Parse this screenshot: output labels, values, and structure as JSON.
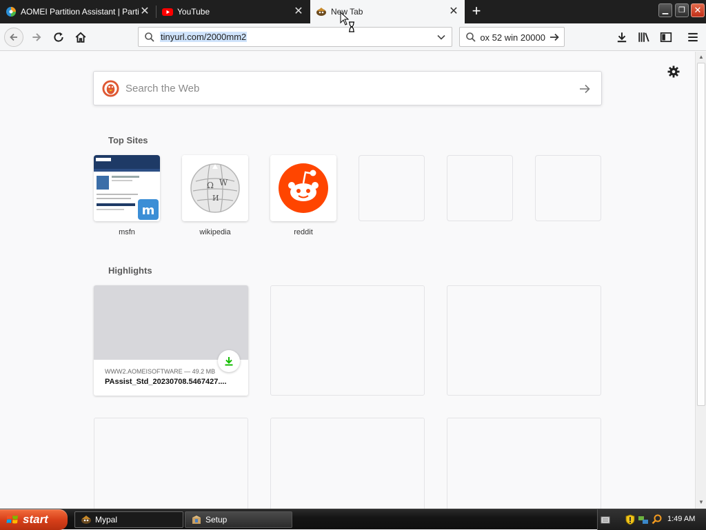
{
  "browser": {
    "tabs": [
      {
        "title": "AOMEI Partition Assistant | Partiti",
        "icon": "aomei-favicon",
        "active": false
      },
      {
        "title": "YouTube",
        "icon": "youtube-favicon",
        "active": false
      },
      {
        "title": "New Tab",
        "icon": "mypal-favicon",
        "active": true
      }
    ],
    "url": "tinyurl.com/2000mm2",
    "search_value": "ox 52 win 20000"
  },
  "newtab": {
    "search_placeholder": "Search the Web",
    "top_sites_heading": "Top Sites",
    "top_sites": [
      {
        "label": "msfn",
        "icon": "msfn-thumbnail"
      },
      {
        "label": "wikipedia",
        "icon": "wikipedia-globe"
      },
      {
        "label": "reddit",
        "icon": "reddit-snoo"
      },
      {
        "label": "",
        "icon": ""
      },
      {
        "label": "",
        "icon": ""
      },
      {
        "label": "",
        "icon": ""
      }
    ],
    "highlights_heading": "Highlights",
    "highlights": [
      {
        "source": "WWW2.AOMEISOFTWARE — 49.2 MB",
        "title": "PAssist_Std_20230708.5467427....",
        "icon": "download-icon",
        "accent": "#12bc00"
      }
    ]
  },
  "taskbar": {
    "start_label": "start",
    "tasks": [
      {
        "label": "Mypal",
        "icon": "mypal-icon",
        "active": true
      },
      {
        "label": "Setup",
        "icon": "setup-icon",
        "active": false
      }
    ],
    "clock": "1:49 AM"
  },
  "colors": {
    "start_button": "#d8401a",
    "reddit": "#ff4500",
    "duckduckgo": "#de5833",
    "close_button": "#c1301a"
  }
}
